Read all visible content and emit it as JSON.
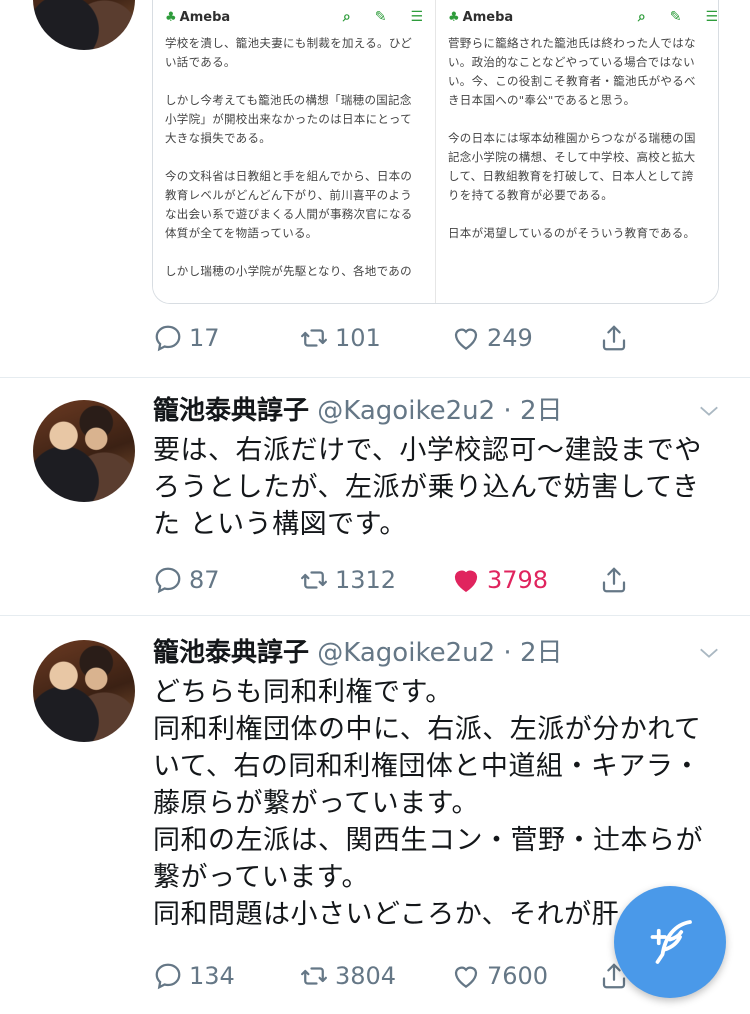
{
  "tweets": [
    {
      "media": {
        "pages": [
          {
            "brand": "Ameba",
            "lines": [
              "学校を潰し、籠池夫妻にも制裁を加える。ひど",
              "い話である。",
              "",
              "しかし今考えても籠池氏の構想「瑞穂の国記念",
              "小学院」が開校出来なかったのは日本にとって",
              "大きな損失である。",
              "",
              "今の文科省は日教組と手を組んでから、日本の",
              "教育レベルがどんどん下がり、前川喜平のよう",
              "な出会い系で遊びまくる人間が事務次官になる",
              "体質が全てを物語っている。",
              "",
              "しかし瑞穂の小学院が先駆となり、各地であの"
            ]
          },
          {
            "brand": "Ameba",
            "lines": [
              "菅野らに籠絡された籠池氏は終わった人ではな",
              "い。政治的なことなどやっている場合ではない",
              "い。今、この役割こそ教育者・籠池氏がやるべ",
              "き日本国への\"奉公\"であると思う。",
              "",
              "今の日本には塚本幼稚園からつながる瑞穂の国",
              "記念小学院の構想、そして中学校、高校と拡大",
              "して、日教組教育を打破して、日本人として誇",
              "りを持てる教育が必要である。",
              "",
              "日本が渇望しているのがそういう教育である。"
            ]
          }
        ]
      },
      "actions": {
        "replies": "17",
        "retweets": "101",
        "likes": "249"
      }
    },
    {
      "name": "籠池泰典諄子",
      "handle": "@Kagoike2u2",
      "time": "2日",
      "lines": [
        "要は、右派だけで、小学校認可〜建設までや",
        "ろうとしたが、左派が乗り込んで妨害してき",
        "た という構図です。"
      ],
      "actions": {
        "replies": "87",
        "retweets": "1312",
        "likes": "3798",
        "liked": true
      }
    },
    {
      "name": "籠池泰典諄子",
      "handle": "@Kagoike2u2",
      "time": "2日",
      "lines": [
        "どちらも同和利権です。",
        "同和利権団体の中に、右派、左派が分かれて",
        "いて、右の同和利権団体と中道組・キアラ・",
        "藤原らが繋がっています。",
        "同和の左派は、関西生コン・菅野・辻本らが",
        "繋がっています。",
        "同和問題は小さいどころか、それが肝"
      ],
      "actions": {
        "replies": "134",
        "retweets": "3804",
        "likes": "7600"
      }
    }
  ],
  "colors": {
    "accent": "#1da1f2",
    "like": "#e0245e",
    "muted": "#657786",
    "fab": "#4a99e9",
    "ameba_green": "#2e9c3b"
  },
  "icons": [
    "reply-icon",
    "retweet-icon",
    "like-icon",
    "share-icon",
    "chevron-down-icon",
    "compose-tweet-icon",
    "ameba-frog-icon",
    "search-icon",
    "pencil-icon",
    "menu-icon"
  ]
}
